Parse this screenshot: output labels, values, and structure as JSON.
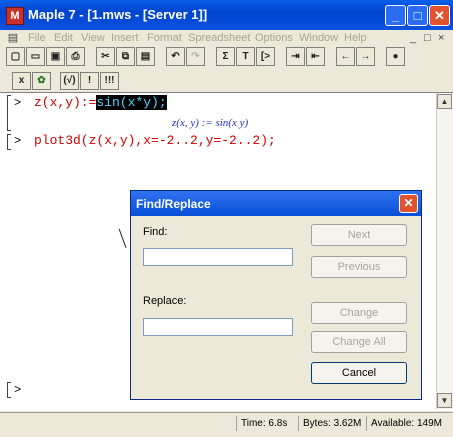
{
  "window": {
    "title": "Maple 7 - [1.mws - [Server 1]]",
    "min_label": "_",
    "max_label": "□",
    "close_label": "✕"
  },
  "menu": {
    "items": [
      "File",
      "Edit",
      "View",
      "Insert",
      "Format",
      "Spreadsheet",
      "Options",
      "Window",
      "Help"
    ],
    "mdi_controls": [
      "_",
      "□",
      "×"
    ]
  },
  "toolbar": {
    "buttons": [
      "new",
      "open",
      "save",
      "print",
      "cut",
      "copy",
      "paste",
      "undo",
      "redo",
      "Σ",
      "T",
      "[>",
      "indent",
      "outdent",
      "←",
      "→",
      "stop"
    ]
  },
  "toolbar2": {
    "buttons": [
      "x",
      "✿",
      "(√)",
      "!",
      "!!!"
    ]
  },
  "worksheet": {
    "prompt_symbol": ">",
    "input1_prefix": "z(x,y):=",
    "input1_selected": "sin(x*y);",
    "output1": "z(x, y) := sin(x y)",
    "input2": "plot3d(z(x,y),x=-2..2,y=-2..2);",
    "empty_prompt": ">"
  },
  "status": {
    "time_label": "Time:",
    "time_value": "6.8s",
    "bytes": "Bytes: 3.62M",
    "available": "Available: 149M"
  },
  "dialog": {
    "title": "Find/Replace",
    "close_label": "✕",
    "find_label": "Find:",
    "find_value": "",
    "replace_label": "Replace:",
    "replace_value": "",
    "buttons": {
      "next": "Next",
      "previous": "Previous",
      "change": "Change",
      "change_all": "Change All",
      "cancel": "Cancel"
    }
  }
}
